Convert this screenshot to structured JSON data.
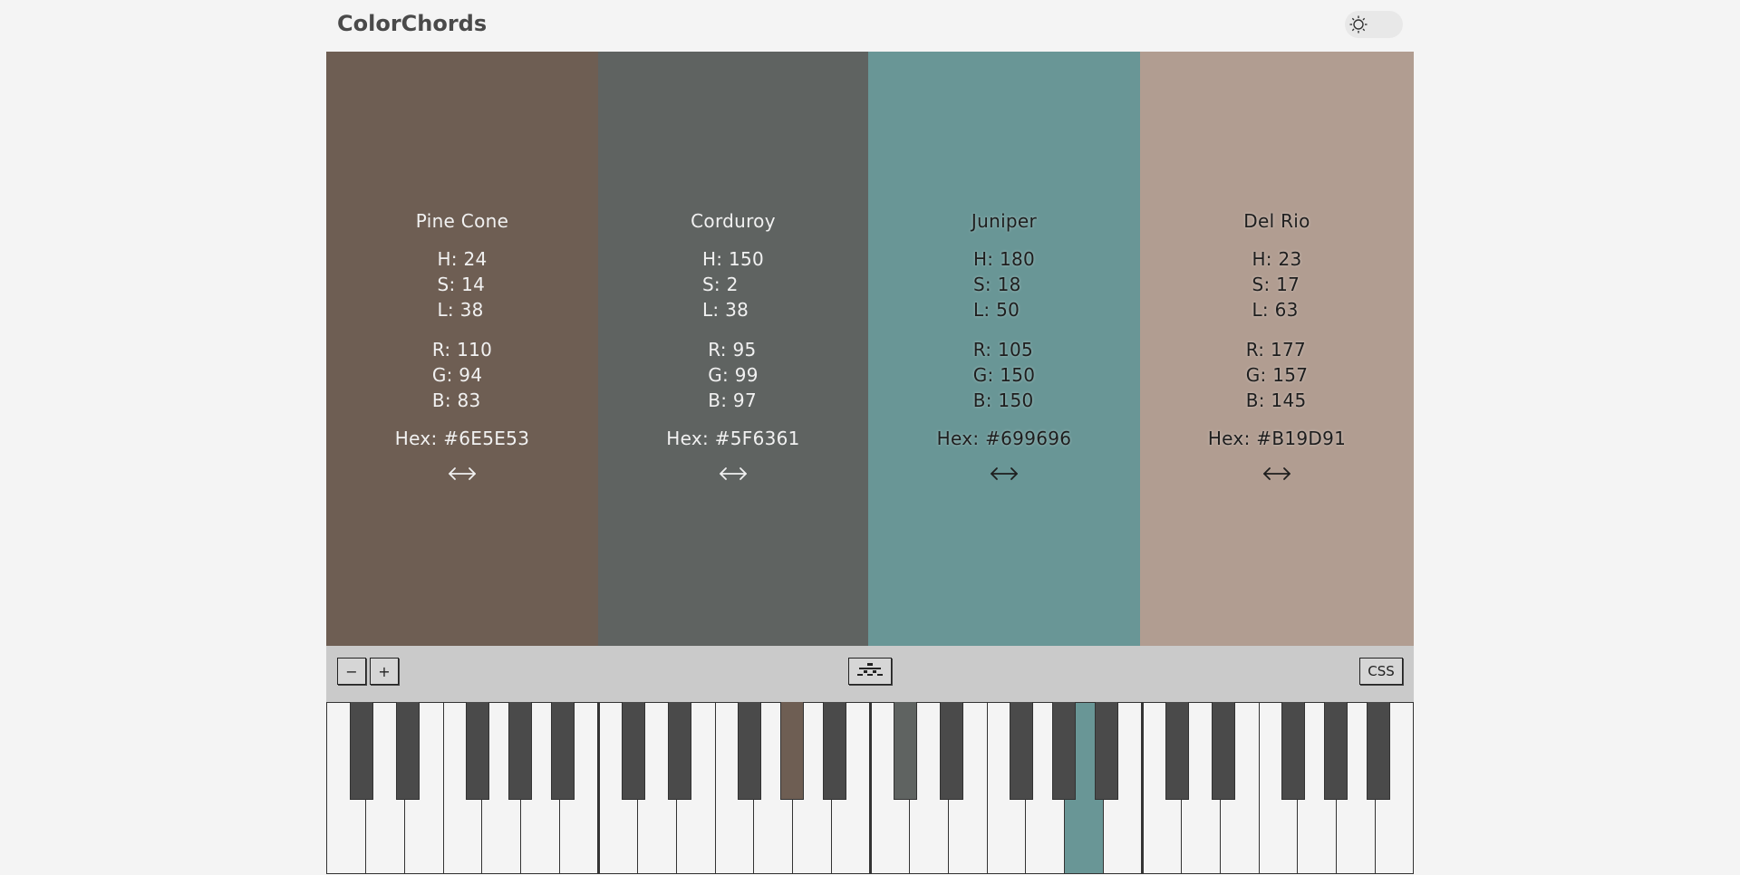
{
  "app": {
    "title": "ColorChords"
  },
  "theme_toggle": {
    "icon": "sun-icon"
  },
  "swatches": [
    {
      "name": "Pine Cone",
      "h": "H: 24",
      "s": "S: 14",
      "l": "L: 38",
      "r": "R: 110",
      "g": "G: 94",
      "b": "B: 83",
      "hex": "Hex: #6E5E53",
      "color": "#6E5E53",
      "text_tone": "light",
      "resize_icon": "left-right-arrow-icon"
    },
    {
      "name": "Corduroy",
      "h": "H: 150",
      "s": "S: 2",
      "l": "L: 38",
      "r": "R: 95",
      "g": "G: 99",
      "b": "B: 97",
      "hex": "Hex: #5F6361",
      "color": "#5F6361",
      "text_tone": "light",
      "resize_icon": "left-right-arrow-icon"
    },
    {
      "name": "Juniper",
      "h": "H: 180",
      "s": "S: 18",
      "l": "L: 50",
      "r": "R: 105",
      "g": "G: 150",
      "b": "B: 150",
      "hex": "Hex: #699696",
      "color": "#699696",
      "text_tone": "dark",
      "resize_icon": "left-right-arrow-icon"
    },
    {
      "name": "Del Rio",
      "h": "H: 23",
      "s": "S: 17",
      "l": "L: 63",
      "r": "R: 177",
      "g": "G: 157",
      "b": "B: 145",
      "hex": "Hex: #B19D91",
      "color": "#B19D91",
      "text_tone": "dark",
      "resize_icon": "left-right-arrow-icon"
    }
  ],
  "toolbar": {
    "minus_label": "−",
    "plus_label": "+",
    "center_icon": "piano-layout-icon",
    "css_label": "CSS"
  },
  "piano": {
    "white_key_color": "#f4f4f4",
    "black_key_color": "#4a4a4a",
    "highlighted_keys": [
      {
        "key": "black-8",
        "color": "#6E5E53"
      },
      {
        "key": "black-10",
        "color": "#5F6361"
      },
      {
        "key": "white-19",
        "color": "#699696"
      },
      {
        "key": "black-21",
        "color": "#B19D91"
      }
    ]
  }
}
